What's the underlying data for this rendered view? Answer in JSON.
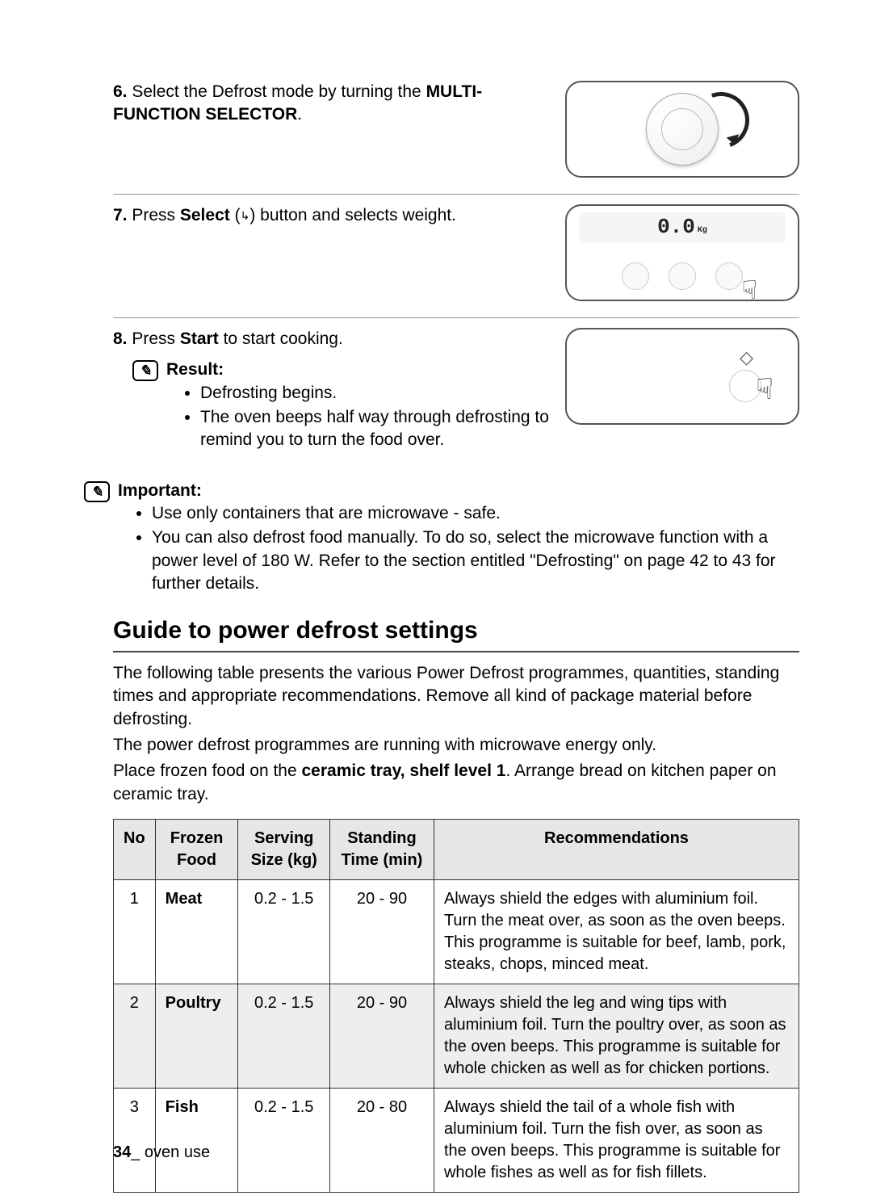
{
  "steps": {
    "s6": {
      "num": "6.",
      "text_before": "Select the Defrost mode by turning the ",
      "bold": "MULTI-FUNCTION SELECTOR",
      "text_after": "."
    },
    "s7": {
      "num": "7.",
      "text_before": "Press ",
      "bold1": "Select",
      "text_mid": " (",
      "icon": "↳",
      "text_mid2": ") button and selects weight.",
      "display_value": "0.0",
      "display_unit": "Kg"
    },
    "s8": {
      "num": "8.",
      "text_before": "Press ",
      "bold": "Start",
      "text_after": " to start cooking."
    }
  },
  "result": {
    "title": "Result:",
    "items": [
      "Defrosting begins.",
      "The oven beeps half way through defrosting to remind you to turn the food over."
    ]
  },
  "important": {
    "title": "Important:",
    "items": [
      "Use only containers that are microwave - safe.",
      "You can also defrost food manually. To do so, select the microwave function with a power level of 180 W. Refer to the section entitled \"Defrosting\" on page 42 to 43 for further details."
    ]
  },
  "guide": {
    "heading": "Guide to power defrost settings",
    "intro1": "The following table presents the various Power Defrost programmes, quantities, standing times and appropriate recommendations. Remove all kind of package material before defrosting.",
    "intro2": "The power defrost programmes are running with microwave energy only.",
    "intro3a": "Place frozen food on the ",
    "intro3b": "ceramic tray, shelf level 1",
    "intro3c": ". Arrange bread on kitchen paper on ceramic tray."
  },
  "table": {
    "headers": {
      "no": "No",
      "food": "Frozen Food",
      "size": "Serving Size (kg)",
      "time": "Standing Time (min)",
      "rec": "Recommendations"
    },
    "rows": [
      {
        "no": "1",
        "food": "Meat",
        "size": "0.2 - 1.5",
        "time": "20 - 90",
        "rec": "Always shield the edges with aluminium foil. Turn the meat over, as soon as the oven beeps. This programme is suitable for beef, lamb, pork, steaks, chops, minced meat."
      },
      {
        "no": "2",
        "food": "Poultry",
        "size": "0.2 - 1.5",
        "time": "20 - 90",
        "rec": "Always shield the leg and wing tips with aluminium foil. Turn the poultry over, as soon as the oven beeps. This programme is suitable for whole chicken as well as for chicken portions."
      },
      {
        "no": "3",
        "food": "Fish",
        "size": "0.2 - 1.5",
        "time": "20 - 80",
        "rec": "Always shield the tail of a whole fish with aluminium foil. Turn the fish over, as soon as the oven beeps. This programme is suitable for whole fishes as well as for fish fillets."
      }
    ]
  },
  "chart_data": {
    "type": "table",
    "title": "Guide to power defrost settings",
    "columns": [
      "No",
      "Frozen Food",
      "Serving Size (kg)",
      "Standing Time (min)",
      "Recommendations"
    ],
    "rows": [
      [
        1,
        "Meat",
        "0.2 - 1.5",
        "20 - 90",
        "Always shield the edges with aluminium foil. Turn the meat over, as soon as the oven beeps. This programme is suitable for beef, lamb, pork, steaks, chops, minced meat."
      ],
      [
        2,
        "Poultry",
        "0.2 - 1.5",
        "20 - 90",
        "Always shield the leg and wing tips with aluminium foil. Turn the poultry over, as soon as the oven beeps. This programme is suitable for whole chicken as well as for chicken portions."
      ],
      [
        3,
        "Fish",
        "0.2 - 1.5",
        "20 - 80",
        "Always shield the tail of a whole fish with aluminium foil. Turn the fish over, as soon as the oven beeps. This programme is suitable for whole fishes as well as for fish fillets."
      ]
    ]
  },
  "footer": {
    "page": "34",
    "sep": "_",
    "section": " oven use"
  }
}
